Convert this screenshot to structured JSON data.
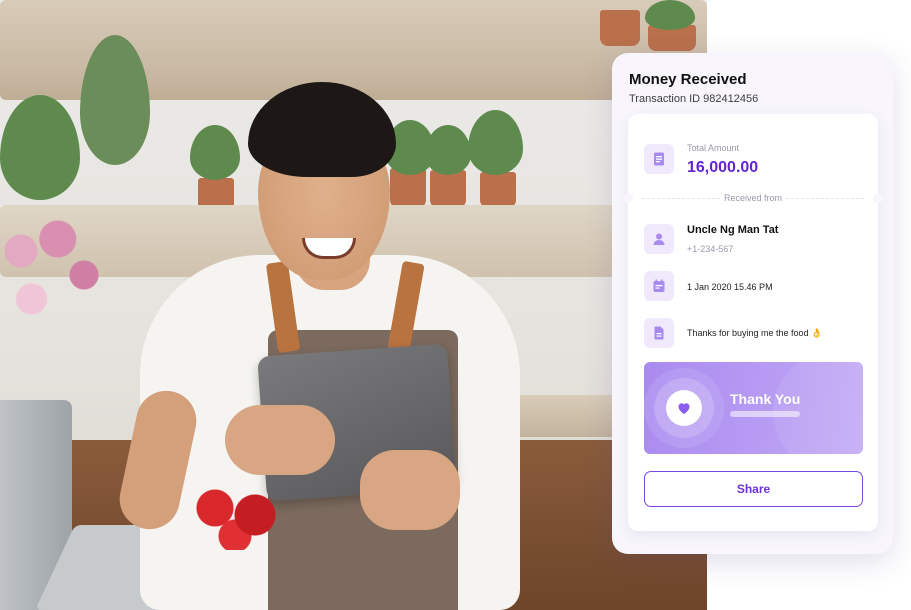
{
  "card": {
    "title": "Money Received",
    "transaction": "Transaction ID 982412456",
    "amount_label": "Total Amount",
    "amount": "16,000.00",
    "received_from": "Received from",
    "sender_name": "Uncle Ng Man Tat",
    "sender_phone": "+1-234-567",
    "date": "1 Jan 2020 15.46 PM",
    "note": "Thanks for buying me the food 👌",
    "banner_text": "Thank You",
    "share_label": "Share"
  },
  "icons": {
    "amount": "receipt-icon",
    "sender": "user-icon",
    "date": "calendar-icon",
    "note": "document-icon",
    "banner": "heart-icon"
  },
  "colors": {
    "accent": "#6424d6",
    "icon_bg": "#efe9fb",
    "banner": "#a98bf0"
  }
}
